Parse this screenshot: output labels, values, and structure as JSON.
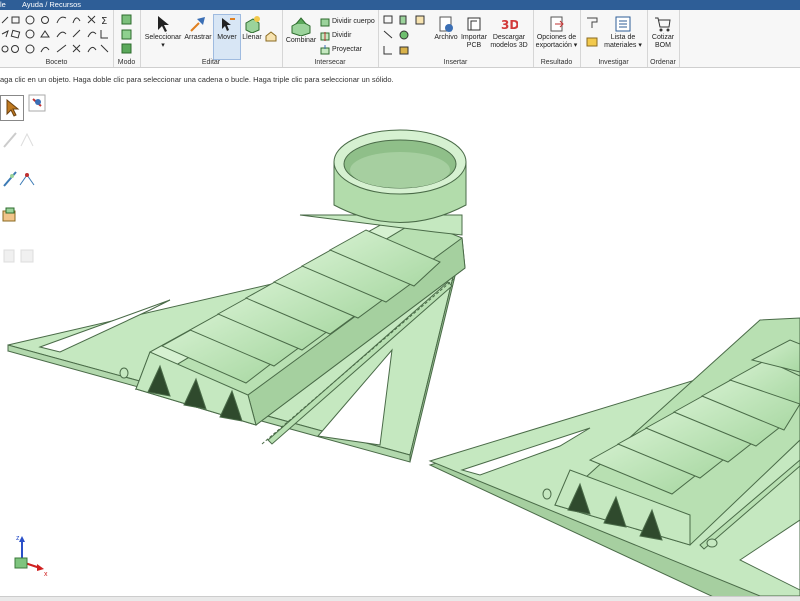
{
  "menu": {
    "items": [
      "le",
      "Ayuda / Recursos"
    ]
  },
  "ribbon": {
    "groups": {
      "boceto": "Boceto",
      "modo": "Modo",
      "editar": "Editar",
      "intersecar": "Intersecar",
      "insertar": "Insertar",
      "resultado": "Resultado",
      "investigar": "Investigar",
      "ordenar": "Ordenar"
    },
    "buttons": {
      "seleccionar": "Seleccionar",
      "arrastrar": "Arrastrar",
      "mover": "Mover",
      "llenar": "Llenar",
      "combinar": "Combinar",
      "dividir_cuerpo": "Dividir cuerpo",
      "dividir": "Dividir",
      "proyectar": "Proyectar",
      "archivo": "Archivo",
      "importar_pcb_1": "Importar",
      "importar_pcb_2": "PCB",
      "descargar_1": "Descargar",
      "descargar_2": "modelos 3D",
      "opciones_1": "Opciones de",
      "opciones_2": "exportación ▾",
      "lista_1": "Lista de",
      "lista_2": "materiales ▾",
      "cotizar_1": "Cotizar",
      "cotizar_2": "BOM"
    }
  },
  "status_hint": "aga clic en un objeto. Haga doble clic para seleccionar una cadena o bucle. Haga triple clic para seleccionar un sólido.",
  "triad": {
    "x_label": "x",
    "z_label": "z"
  },
  "colors": {
    "model_fill": "#c5e8c0",
    "model_edge": "#4a6b48",
    "accent": "#2e5e97",
    "active_bg": "#d8e6f5"
  },
  "icons": [
    "line-icon",
    "rectangle-icon",
    "circle-icon",
    "arc-icon",
    "spline-icon",
    "sigma-icon",
    "select-arrow-icon",
    "pull-icon",
    "move-icon",
    "fill-icon",
    "combine-icon",
    "split-body-icon",
    "split-icon",
    "project-icon",
    "file-icon",
    "pcb-icon",
    "3d-icon",
    "export-icon",
    "measure-icon",
    "bom-icon",
    "cart-icon"
  ]
}
